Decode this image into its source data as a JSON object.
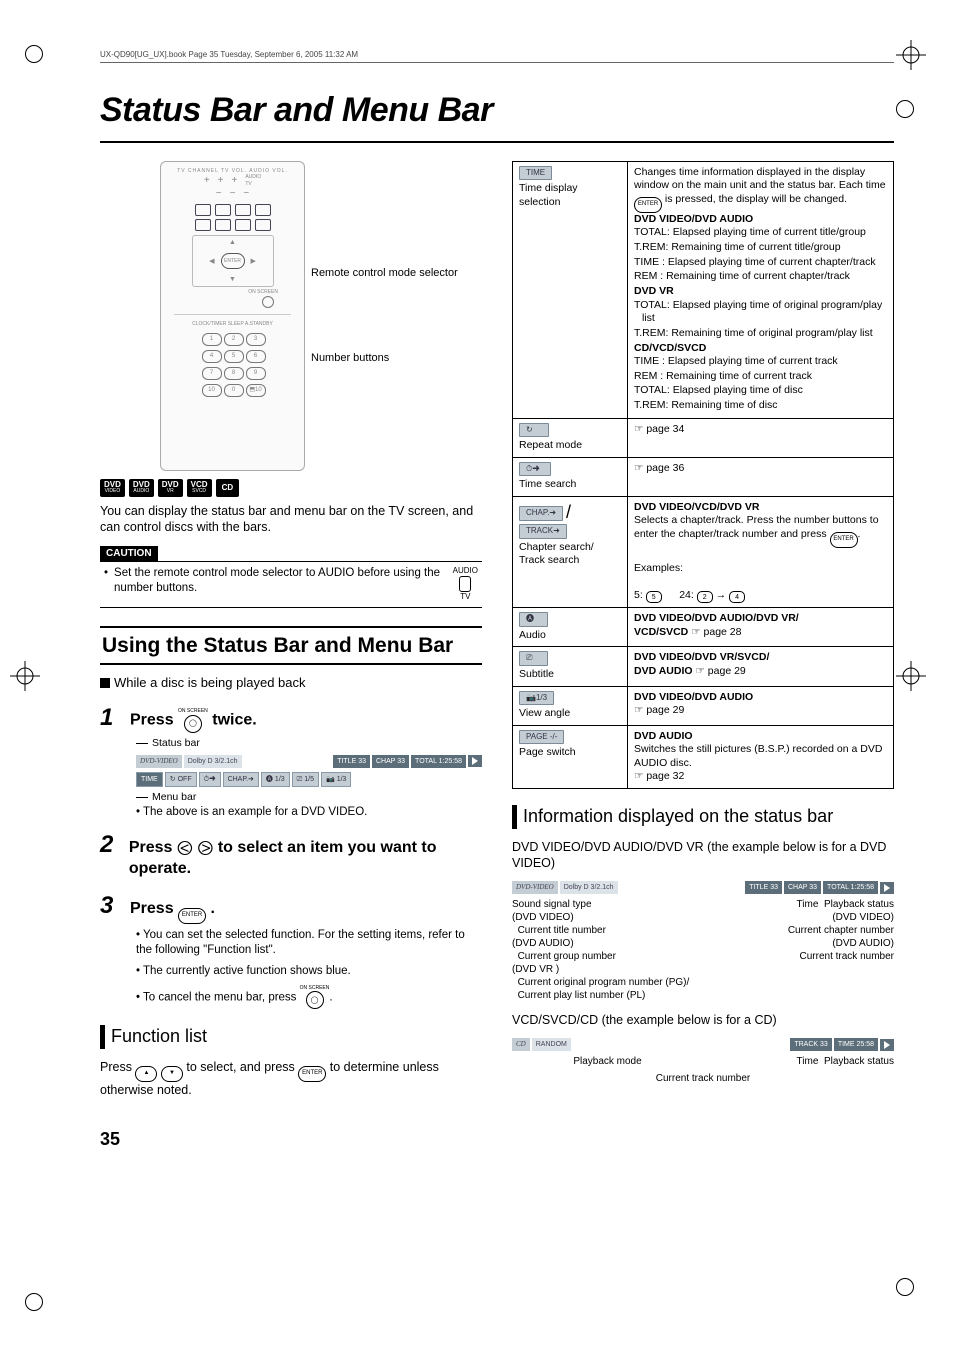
{
  "header": {
    "book_line": "UX-QD90[UG_UX].book  Page 35  Tuesday, September 6, 2005  11:32 AM"
  },
  "title": "Status Bar and Menu Bar",
  "left": {
    "remote": {
      "mode_selector": "Remote control mode selector",
      "number_buttons": "Number buttons",
      "enter": "ENTER",
      "on_screen": "ON SCREEN",
      "top_labels": "TV CHANNEL   TV VOL.    AUDIO VOL.",
      "audio_tv": "AUDIO / TV"
    },
    "disc_badges": {
      "dvd_video": "DVD",
      "dvd_video_sub": "VIDEO",
      "dvd_audio": "DVD",
      "dvd_audio_sub": "AUDIO",
      "dvd_vr": "DVD",
      "dvd_vr_sub": "VR",
      "vcd": "VCD",
      "vcd_sub": "SVCD",
      "cd": "CD"
    },
    "intro": "You can display the status bar and menu bar on the TV screen, and can control discs with the bars.",
    "caution_label": "CAUTION",
    "caution_text": "Set the remote control mode selector to AUDIO before using the number buttons.",
    "caution_switch": "AUDIO / TV",
    "section_head": "Using the Status Bar and Menu Bar",
    "while_playing": "While a disc is being played back",
    "step1": "Press",
    "step1b": "twice.",
    "step1_btn_label": "ON SCREEN",
    "status_bar_label": "Status bar",
    "menu_bar_label": "Menu bar",
    "status_bar": {
      "disc": "DVD-VIDEO",
      "sound": "Dolby D 3/2.1ch",
      "title": "TITLE 33",
      "chap": "CHAP 33",
      "total": "TOTAL  1:25:58"
    },
    "menu_bar": {
      "time": "TIME",
      "repeat_off": "OFF",
      "chap_arrow": "CHAP.➜",
      "audio": "1/3",
      "sub": "1/5",
      "angle": "1/3"
    },
    "step1_note": "The above is an example for a DVD VIDEO.",
    "step2": "Press",
    "step2b": "to select an item you want to operate.",
    "step3": "Press",
    "step3b": ".",
    "step3_btn": "ENTER",
    "step3_note1": "You can set the selected function. For the setting items, refer to the following \"Function list\".",
    "step3_note2": "The currently active function shows blue.",
    "step3_note3a": "To cancel the menu bar, press",
    "step3_note3_btn": "ON SCREEN",
    "function_list": "Function list",
    "func_intro_a": "Press",
    "func_intro_b": "to select, and press",
    "func_intro_c": "to determine unless otherwise noted.",
    "func_intro_enter": "ENTER"
  },
  "right": {
    "rows": {
      "time": {
        "chip": "TIME",
        "sublabel": "Time display selection",
        "desc_a": "Changes time information displayed in the display window on the main unit and the status bar. Each time",
        "desc_b": "is pressed, the display will be changed.",
        "enter": "ENTER",
        "h1": "DVD VIDEO/DVD AUDIO",
        "d1": [
          "TOTAL: Elapsed playing time of current title/group",
          "T.REM: Remaining time of current title/group",
          "TIME  : Elapsed playing time of current chapter/track",
          "REM  : Remaining time of current chapter/track"
        ],
        "h2": "DVD VR",
        "d2": [
          "TOTAL: Elapsed playing time of original program/play list",
          "T.REM: Remaining time of original program/play list"
        ],
        "h3": "CD/VCD/SVCD",
        "d3": [
          "TIME  : Elapsed playing time of current track",
          "REM  : Remaining time of current track",
          "TOTAL: Elapsed playing time of disc",
          "T.REM: Remaining time of disc"
        ]
      },
      "repeat": {
        "sublabel": "Repeat mode",
        "ref": "page 34"
      },
      "timesearch": {
        "sublabel": "Time search",
        "ref": "page 36"
      },
      "chap": {
        "chip1": "CHAP.➜",
        "chip2": "TRACK➜",
        "slash": "/",
        "sublabel": "Chapter search/ Track search",
        "head": "DVD VIDEO/VCD/DVD VR",
        "desc_a": "Selects a chapter/track. Press the number buttons to enter the chapter/track number and press",
        "enter": "ENTER",
        "desc_b": ".",
        "examples_label": "Examples:",
        "ex1": "5:",
        "ex1_btn": "5",
        "ex2": "24:",
        "ex2_btn1": "2",
        "ex2_btn2": "4"
      },
      "audio": {
        "sublabel": "Audio",
        "head": "DVD VIDEO/DVD AUDIO/DVD VR/",
        "head2": "VCD/SVCD",
        "ref": "page 28"
      },
      "subtitle": {
        "sublabel": "Subtitle",
        "head": "DVD VIDEO/DVD VR/SVCD/",
        "head2": "DVD AUDIO",
        "ref": "page 29"
      },
      "angle": {
        "chip": "1/3",
        "sublabel": "View angle",
        "head": "DVD VIDEO/DVD AUDIO",
        "ref": "page 29"
      },
      "page": {
        "chip": "PAGE  -/-",
        "sublabel": "Page switch",
        "head": "DVD AUDIO",
        "desc": "Switches the still pictures (B.S.P.) recorded on a DVD AUDIO disc.",
        "ref": "page 32"
      }
    },
    "info_head": "Information displayed on the status bar",
    "info_sub1": "DVD VIDEO/DVD AUDIO/DVD VR (the example below is for a DVD VIDEO)",
    "sb_dvd": {
      "disc": "DVD-VIDEO",
      "sound": "Dolby D 3/2.1ch",
      "title": "TITLE 33",
      "chap": "CHAP 33",
      "total": "TOTAL  1:25:58"
    },
    "callouts_dvd": {
      "left1": "Sound signal type",
      "left2a": "(DVD VIDEO)",
      "left2b": "Current title number",
      "left3a": "(DVD AUDIO)",
      "left3b": "Current group number",
      "left4a": "(DVD VR )",
      "left4b": "Current original program number (PG)/",
      "left4c": "Current play list number (PL)",
      "right1": "Time",
      "right2": "Playback status",
      "right3": "Current chapter number",
      "right4a": "(DVD VIDEO)",
      "right4b": "(DVD AUDIO)",
      "right5": "Current track number"
    },
    "info_sub2": "VCD/SVCD/CD (the example below is for a CD)",
    "sb_cd": {
      "disc": "CD",
      "mode": "RANDOM",
      "track": "TRACK 33",
      "time": "TIME    25:58"
    },
    "callouts_cd": {
      "left": "Playback mode",
      "right1": "Time",
      "right2": "Playback status",
      "bottom": "Current track number"
    }
  },
  "page_num": "35"
}
